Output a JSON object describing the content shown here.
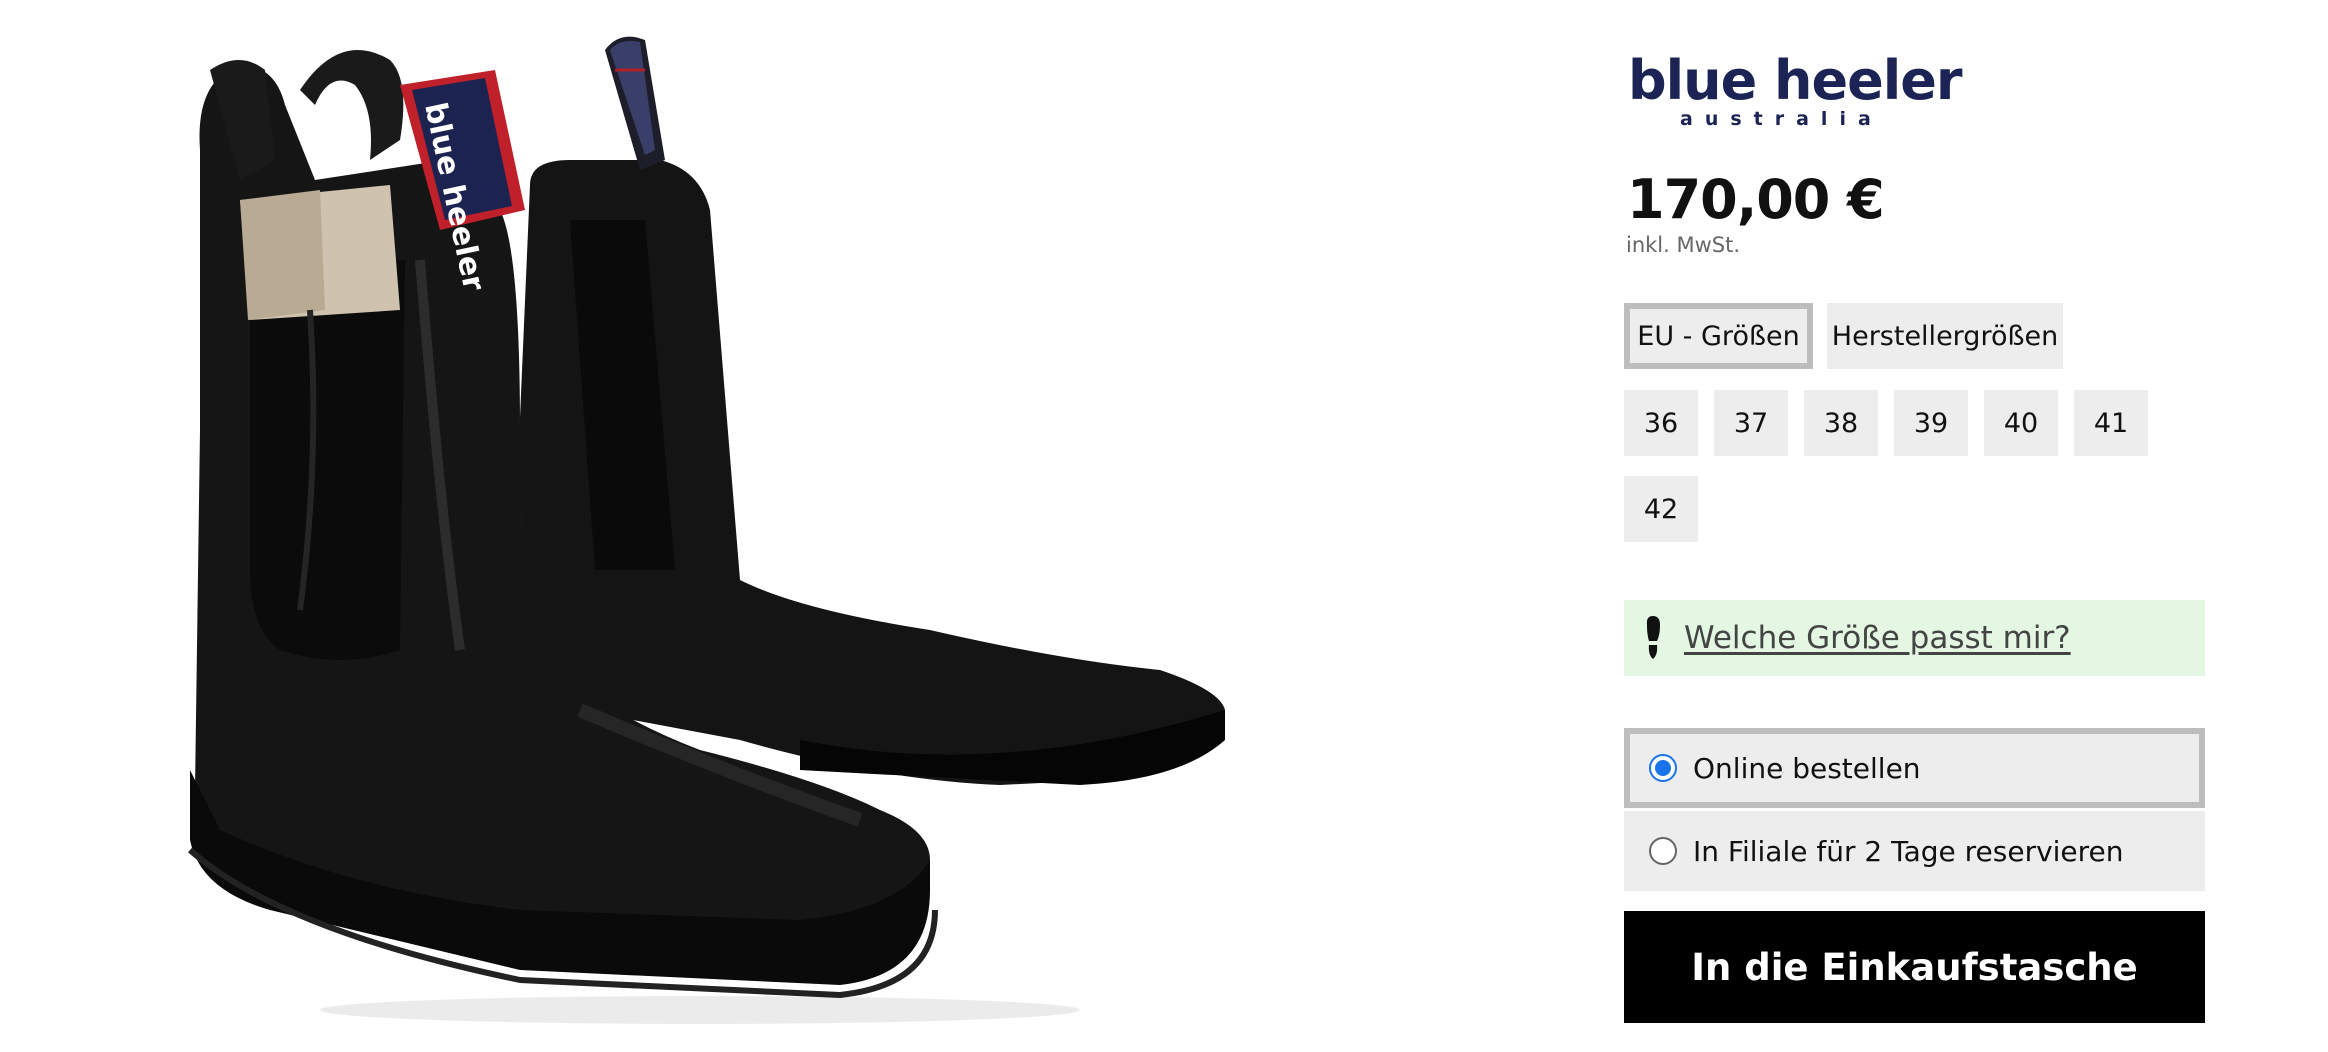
{
  "product": {
    "image_alt": "Schwarze Chelsea Boots",
    "pull_tab_text": "blue heeler",
    "brand_line1": "blue heeler",
    "brand_line2": "australia",
    "price": "170,00 €",
    "tax_note": "inkl. MwSt."
  },
  "size_system": {
    "eu_label": "EU - Größen",
    "maker_label": "Herstellergrößen",
    "selected": "EU - Größen"
  },
  "sizes": [
    "36",
    "37",
    "38",
    "39",
    "40",
    "41",
    "42"
  ],
  "size_help": {
    "label": "Welche Größe passt mir?",
    "icon": "footprint-icon"
  },
  "delivery_options": {
    "online_label": "Online bestellen",
    "store_label": "In Filiale für 2 Tage reservieren",
    "selected": "Online bestellen"
  },
  "cart": {
    "button_label": "In die Einkaufstasche"
  },
  "colors": {
    "brand_navy": "#1b2454",
    "help_bg": "#e3f7e3",
    "radio_selected": "#1a73e8",
    "cta_bg": "#000000",
    "option_bg": "#ededed"
  }
}
